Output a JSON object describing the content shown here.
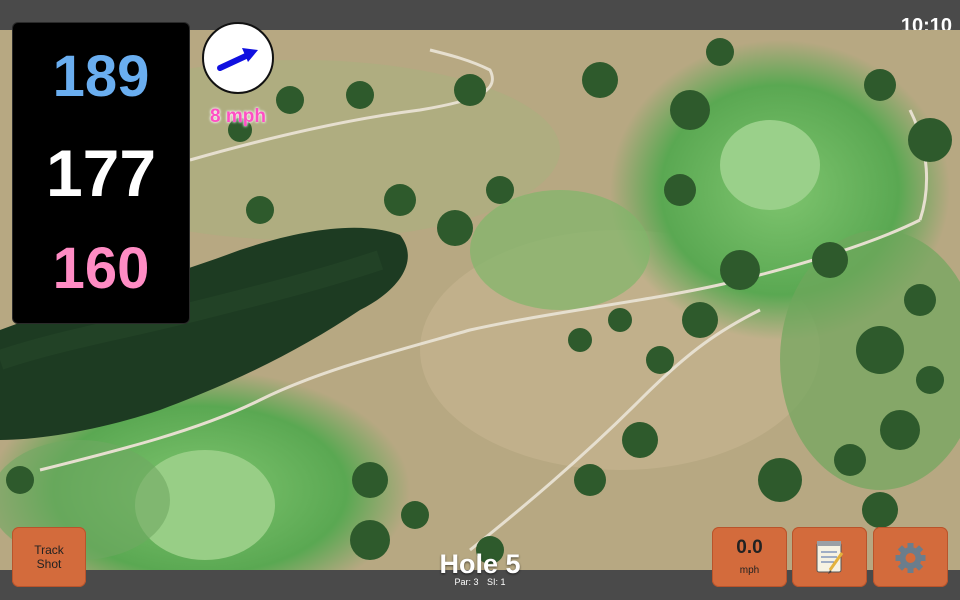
{
  "status": {
    "time": "10:10"
  },
  "distances": {
    "back": "189",
    "middle": "177",
    "front": "160"
  },
  "wind": {
    "speed": "8 mph",
    "icon": "wind-direction-arrow-icon"
  },
  "hole": {
    "title": "Hole 5",
    "par": "Par: 3",
    "stroke_index": "SI: 1"
  },
  "buttons": {
    "track_shot_line1": "Track",
    "track_shot_line2": "Shot",
    "speed_value": "0.0",
    "speed_unit": "mph",
    "notes_icon": "notepad-icon",
    "settings_icon": "gear-icon"
  },
  "colors": {
    "back": "#6aaef0",
    "middle": "#ffffff",
    "front": "#ff8cc4",
    "wind_text": "#ff4fc4",
    "button": "#d36b3c"
  }
}
